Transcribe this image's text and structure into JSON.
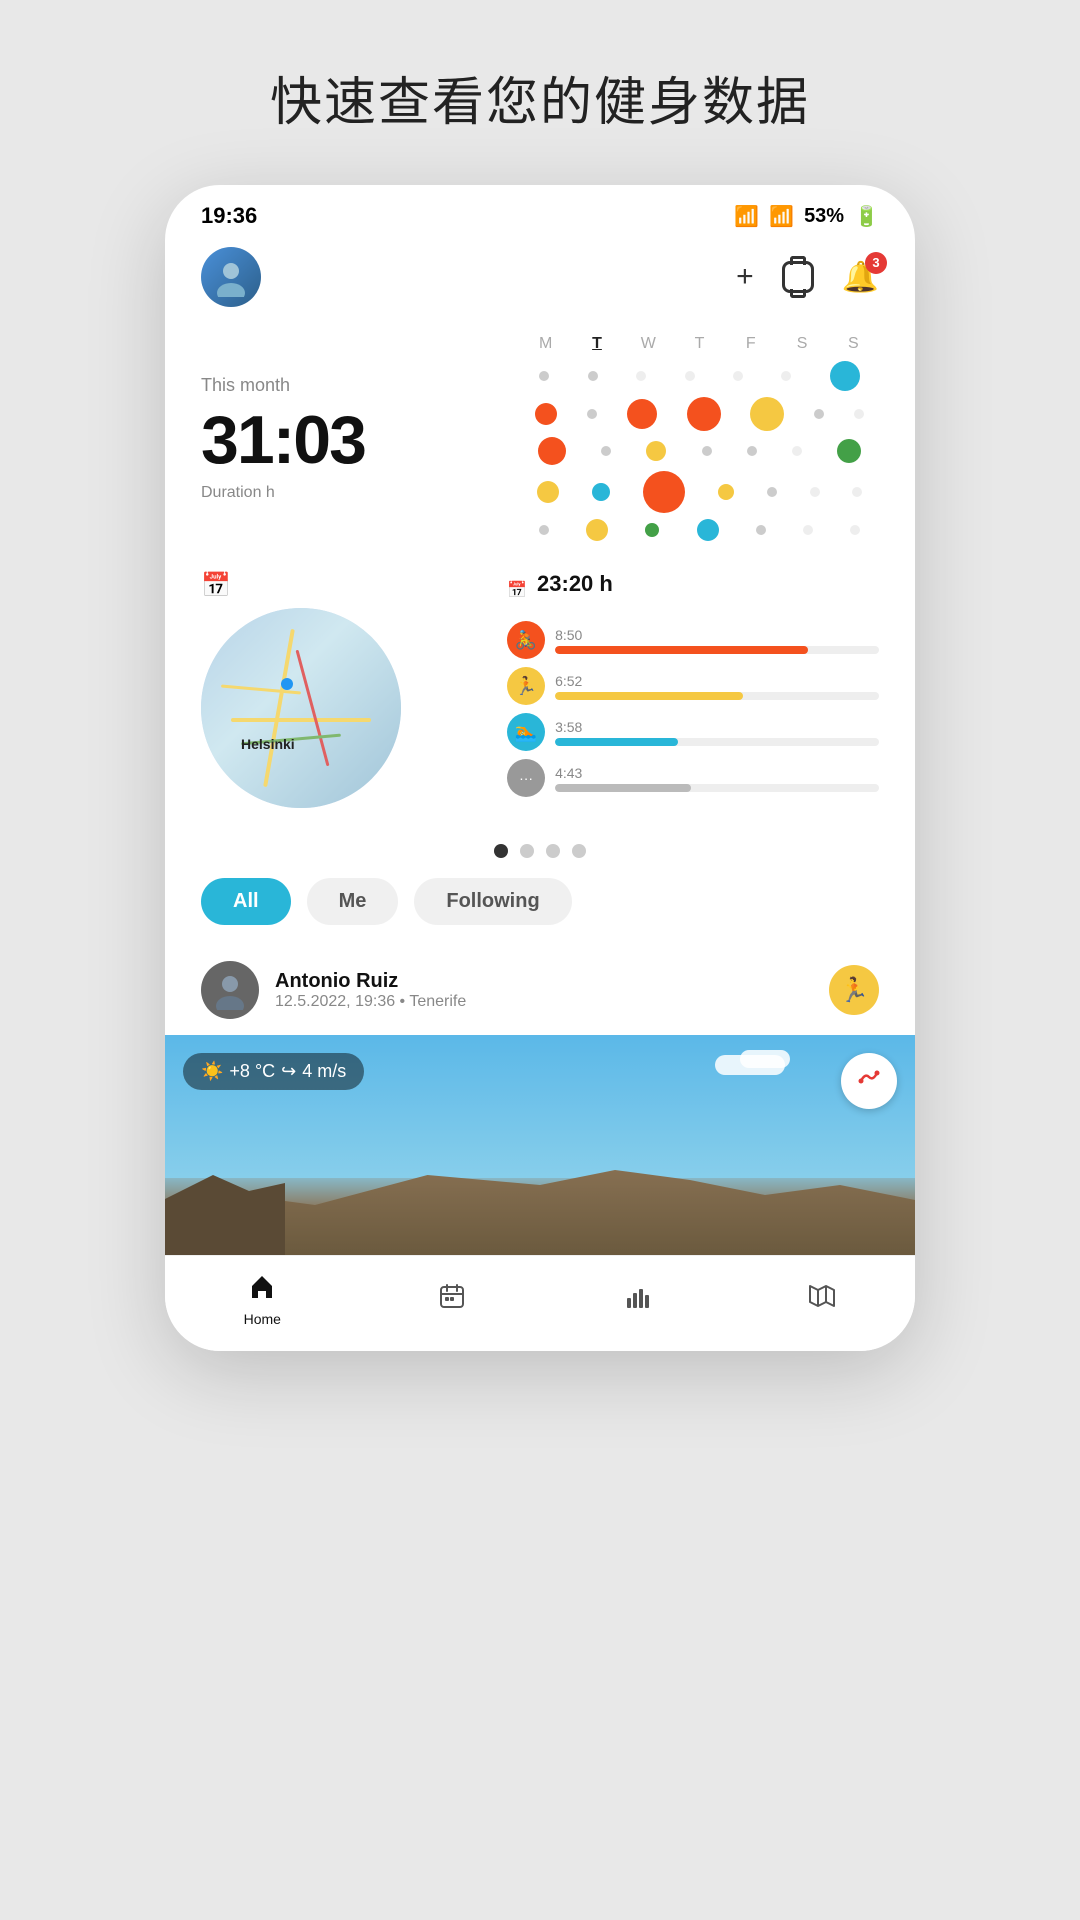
{
  "page": {
    "title": "快速查看您的健身数据"
  },
  "status_bar": {
    "time": "19:36",
    "wifi": "wifi",
    "signal": "signal",
    "battery": "53%"
  },
  "header": {
    "plus_label": "+",
    "notification_count": "3"
  },
  "this_month": {
    "label": "This month",
    "time": "31:03",
    "duration_label": "Duration h"
  },
  "week_labels": [
    "M",
    "T",
    "W",
    "T",
    "F",
    "S",
    "S"
  ],
  "week_active_index": 1,
  "activity_total": {
    "label": "23:20 h",
    "icon": "📅"
  },
  "activities": [
    {
      "time": "8:50",
      "color": "#F4511E",
      "bar_width": "78%",
      "bar_color": "#F4511E",
      "icon": "🚴"
    },
    {
      "time": "6:52",
      "color": "#f5c842",
      "bar_width": "60%",
      "bar_color": "#f5c842",
      "icon": "🏃"
    },
    {
      "time": "3:58",
      "color": "#29b6d8",
      "bar_width": "40%",
      "bar_color": "#29b6d8",
      "icon": "🏊"
    },
    {
      "time": "4:43",
      "color": "#888",
      "bar_width": "45%",
      "bar_color": "#aaa",
      "icon": "···"
    }
  ],
  "filter_tabs": [
    "All",
    "Me",
    "Following"
  ],
  "feed": {
    "user_name": "Antonio Ruiz",
    "user_meta": "12.5.2022, 19:36 • Tenerife",
    "sport_icon": "🏃"
  },
  "weather": {
    "temp": "+8 °C",
    "wind": "4 m/s"
  },
  "nav_items": [
    {
      "label": "Home",
      "icon": "home",
      "active": true
    },
    {
      "label": "Calendar",
      "icon": "calendar",
      "active": false
    },
    {
      "label": "Stats",
      "icon": "stats",
      "active": false
    },
    {
      "label": "Map",
      "icon": "map",
      "active": false
    }
  ]
}
